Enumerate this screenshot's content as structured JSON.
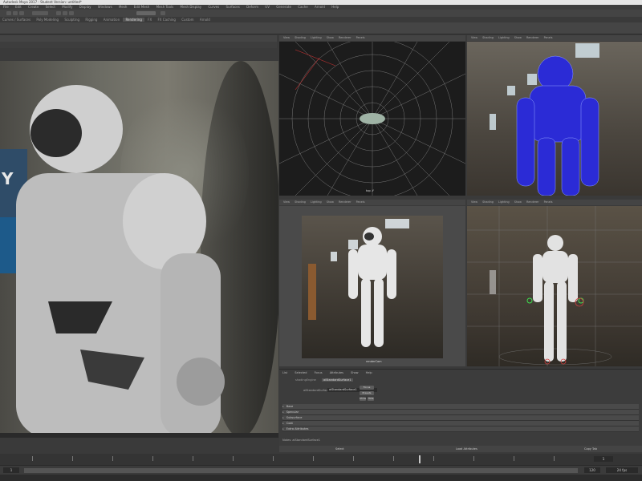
{
  "window": {
    "title": "Autodesk Maya 2017 - Student Version: untitled*"
  },
  "menus": [
    "File",
    "Edit",
    "Create",
    "Select",
    "Modify",
    "Display",
    "Windows",
    "Mesh",
    "Edit Mesh",
    "Mesh Tools",
    "Mesh Display",
    "Curves",
    "Surfaces",
    "Deform",
    "UV",
    "Generate",
    "Cache",
    "Arnold",
    "Help"
  ],
  "shelf_tabs": [
    "Curves / Surfaces",
    "Poly Modeling",
    "Sculpting",
    "Rigging",
    "Animation",
    "Rendering",
    "FX",
    "FX Caching",
    "Custom",
    "Arnold",
    "Bifrost",
    "MASH",
    "Motion Graphics",
    "XGen"
  ],
  "active_shelf_tab": "Rendering",
  "render_view": {
    "overlay_text": "Y",
    "panel_title": "Arnold RenderView"
  },
  "viewports": {
    "top": {
      "menu": [
        "View",
        "Shading",
        "Lighting",
        "Show",
        "Renderer",
        "Panels"
      ],
      "label": "top -Y"
    },
    "uv": {
      "menu": [
        "View",
        "Shading",
        "Lighting",
        "Show",
        "Renderer",
        "Panels"
      ],
      "label": ""
    },
    "persp": {
      "menu": [
        "View",
        "Shading",
        "Lighting",
        "Show",
        "Renderer",
        "Panels"
      ],
      "label": "renderCam"
    },
    "cam": {
      "menu": [
        "View",
        "Shading",
        "Lighting",
        "Show",
        "Renderer",
        "Panels"
      ],
      "label": ""
    }
  },
  "attribute_editor": {
    "tabs": [
      "List",
      "Selected",
      "Focus",
      "Attributes",
      "Show",
      "Help"
    ],
    "node_tabs": [
      "aiStandardSurface1",
      "shadingEngine"
    ],
    "node_label": "aiStandardSurface:",
    "node_value": "aiStandardSurface1",
    "buttons": [
      "Focus",
      "Presets",
      "Show",
      "Hide"
    ],
    "sections": [
      "Base",
      "Specular",
      "Subsurface",
      "Coat",
      "Extra Attributes"
    ],
    "notes_label": "Notes: aiStandardSurface1",
    "footer_buttons": [
      "Select",
      "Load Attributes",
      "Copy Tab"
    ]
  },
  "timeline": {
    "current_frame": "1",
    "range_start": "1",
    "range_end": "120",
    "fps": "24 fps"
  },
  "colors": {
    "panel_bg": "#3a3a3a",
    "wire_blue": "#2b2bd6",
    "selection_green": "#3fe04f"
  }
}
